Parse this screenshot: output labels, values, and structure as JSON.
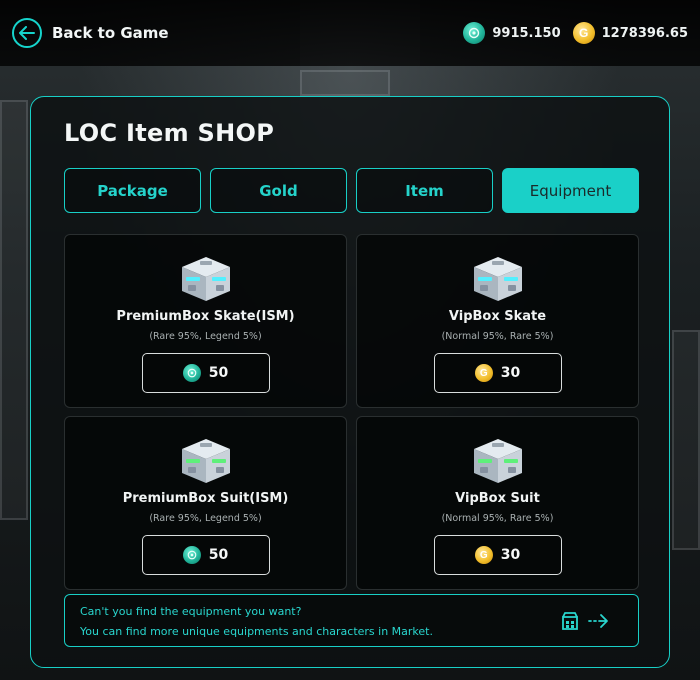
{
  "header": {
    "back_label": "Back to Game",
    "balances": [
      {
        "icon": "teal-token-icon",
        "value": "9915.150"
      },
      {
        "icon": "gold-coin-icon",
        "value": "1278396.65"
      }
    ]
  },
  "shop": {
    "title": "LOC Item SHOP",
    "tabs": [
      {
        "label": "Package",
        "active": false
      },
      {
        "label": "Gold",
        "active": false
      },
      {
        "label": "Item",
        "active": false
      },
      {
        "label": "Equipment",
        "active": true
      }
    ],
    "items": [
      {
        "name": "PremiumBox Skate(ISM)",
        "odds": "(Rare 95%, Legend 5%)",
        "price": "50",
        "currency": "teal-token-icon"
      },
      {
        "name": "VipBox Skate",
        "odds": "(Normal 95%, Rare 5%)",
        "price": "30",
        "currency": "gold-coin-icon"
      },
      {
        "name": "PremiumBox Suit(ISM)",
        "odds": "(Rare 95%, Legend 5%)",
        "price": "50",
        "currency": "teal-token-icon"
      },
      {
        "name": "VipBox Suit",
        "odds": "(Normal 95%, Rare 5%)",
        "price": "30",
        "currency": "gold-coin-icon"
      }
    ],
    "gold_coin_glyph": "G",
    "footer": {
      "line1": "Can't you find the equipment you want?",
      "line2": "You can find more unique equipments and characters in Market."
    }
  },
  "colors": {
    "accent": "#1ad0c8",
    "gold": "#f3bf2c",
    "teal_token": "#21b59a"
  }
}
